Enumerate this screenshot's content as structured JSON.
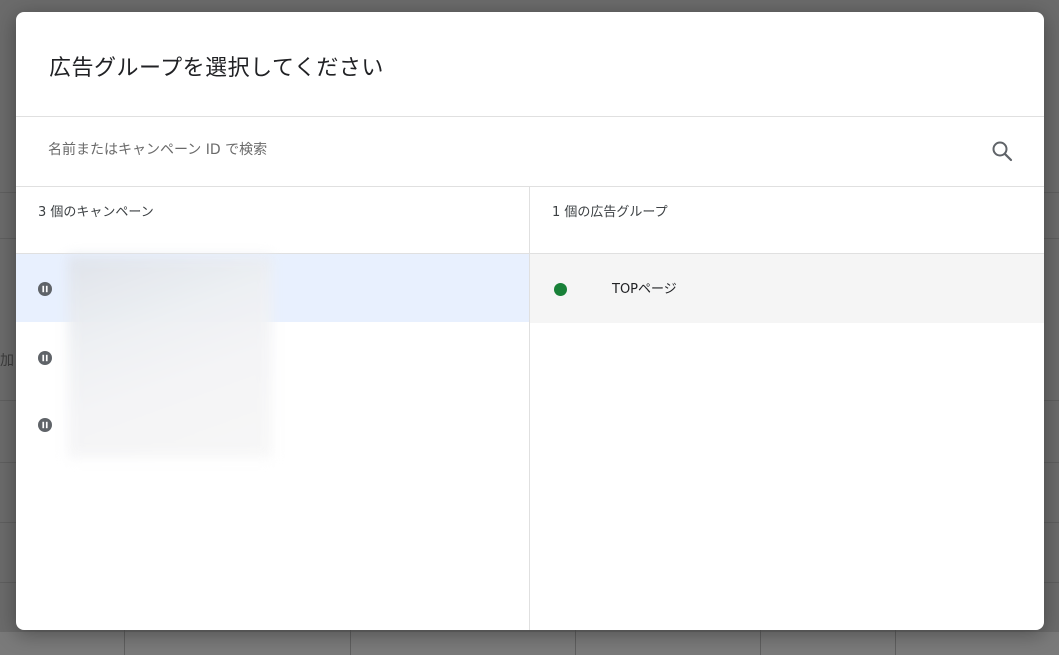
{
  "dialog": {
    "title": "広告グループを選択してください",
    "search": {
      "placeholder": "名前またはキャンペーン ID で検索",
      "value": "",
      "icon": "search-icon"
    },
    "campaigns": {
      "header": "3 個のキャンペーン",
      "items": [
        {
          "status_icon": "paused-icon",
          "name": "",
          "selected": true
        },
        {
          "status_icon": "paused-icon",
          "name": "",
          "selected": false
        },
        {
          "status_icon": "paused-icon",
          "name": "",
          "selected": false
        }
      ]
    },
    "ad_groups": {
      "header": "1 個の広告グループ",
      "items": [
        {
          "status_icon": "enabled-dot-icon",
          "status_color": "#188038",
          "name": "TOPページ"
        }
      ]
    }
  },
  "background": {
    "partial_text": "加"
  },
  "colors": {
    "selected_row": "#e8f0fe",
    "enabled": "#188038",
    "scrim": "#6b6b6b"
  }
}
